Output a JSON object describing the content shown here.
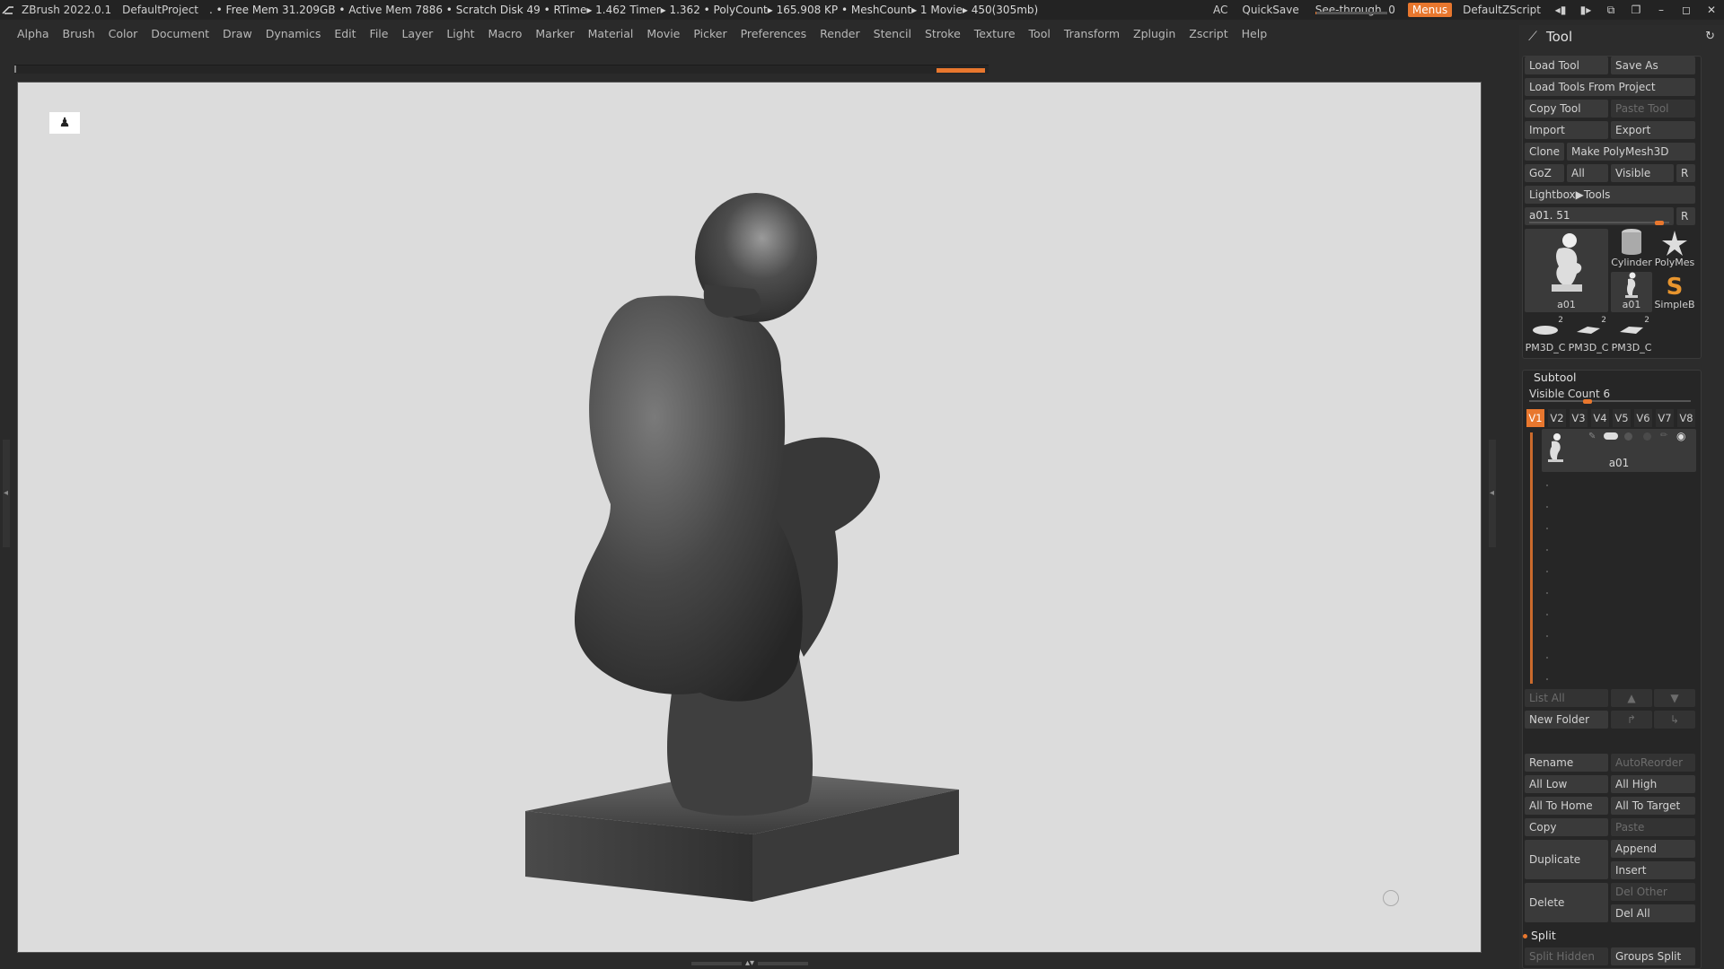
{
  "app": {
    "name_version": "ZBrush 2022.0.1",
    "project": "DefaultProject",
    "status": ". • Free Mem 31.209GB • Active Mem 7886 • Scratch Disk 49 •  RTime▸ 1.462 Timer▸ 1.362 • PolyCount▸ 165.908 KP  • MeshCount▸ 1  Movie▸ 450(305mb)"
  },
  "titlebar_right": {
    "ac": "AC",
    "quicksave": "QuickSave",
    "seethrough_label": "See-through",
    "seethrough_value": "0",
    "seethrough_fraction": 0.0,
    "menus": "Menus",
    "zscript": "DefaultZScript"
  },
  "menubar": [
    "Alpha",
    "Brush",
    "Color",
    "Document",
    "Draw",
    "Dynamics",
    "Edit",
    "File",
    "Layer",
    "Light",
    "Macro",
    "Marker",
    "Material",
    "Movie",
    "Picker",
    "Preferences",
    "Render",
    "Stencil",
    "Stroke",
    "Texture",
    "Tool",
    "Transform",
    "Zplugin",
    "Zscript",
    "Help"
  ],
  "colors": {
    "accent": "#e8772e",
    "canvas_bg": "#dcdcdc",
    "ui_bg": "#2a2a2a",
    "model": "#4a4a4a"
  },
  "icons": {
    "logo": "zbrush-logo-icon",
    "canvas_corner": "figure-icon",
    "tool_header": "brush-icon",
    "refresh": "refresh-icon"
  },
  "tool_panel": {
    "title": "Tool",
    "load_tool": "Load Tool",
    "save_as": "Save As",
    "load_tools_from_project": "Load Tools From Project",
    "copy_tool": "Copy Tool",
    "paste_tool": "Paste Tool",
    "import": "Import",
    "export": "Export",
    "clone": "Clone",
    "make_polymesh": "Make PolyMesh3D",
    "goz": "GoZ",
    "all": "All",
    "visible": "Visible",
    "r": "R",
    "lightbox_tools": "Lightbox▶Tools",
    "current_tool_slider": "a01. 51",
    "current_tool_fraction": 0.96,
    "r2": "R",
    "thumbs": {
      "main": "a01",
      "cylinder": "Cylinder",
      "polymesh": "PolyMes",
      "a01_small": "a01",
      "simpleb": "SimpleB",
      "pm1": "PM3D_C",
      "pm2": "PM3D_C",
      "pm3": "PM3D_C",
      "badge": "2"
    },
    "subtool": {
      "title": "Subtool",
      "visible_count": "Visible Count 6",
      "visible_fraction": 0.35,
      "tabs": [
        "V1",
        "V2",
        "V3",
        "V4",
        "V5",
        "V6",
        "V7",
        "V8"
      ],
      "item_name": "a01",
      "list_all": "List All",
      "new_folder": "New Folder",
      "rename": "Rename",
      "autoreorder": "AutoReorder",
      "all_low": "All Low",
      "all_high": "All High",
      "all_to_home": "All To Home",
      "all_to_target": "All To Target",
      "copy": "Copy",
      "paste": "Paste",
      "duplicate": "Duplicate",
      "append": "Append",
      "insert": "Insert",
      "delete": "Delete",
      "del_other": "Del Other",
      "del_all": "Del All",
      "split": "Split",
      "split_hidden": "Split Hidden",
      "groups_split": "Groups Split"
    }
  }
}
